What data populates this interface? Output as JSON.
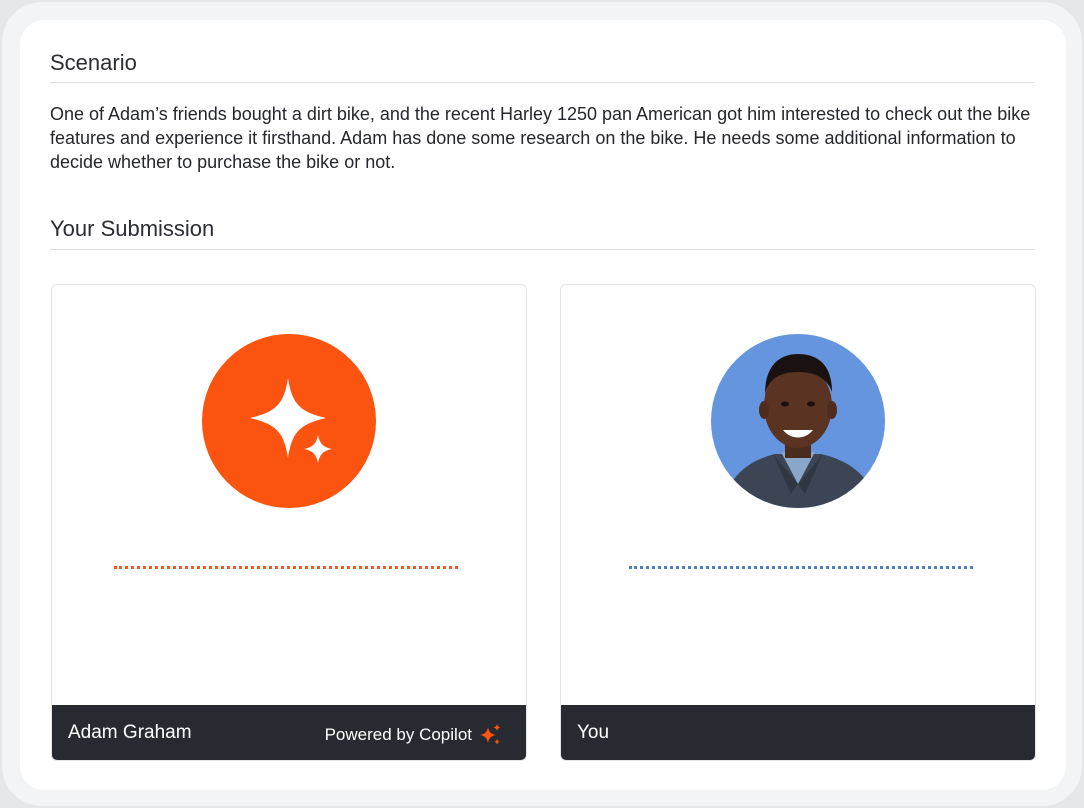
{
  "scenario": {
    "heading": "Scenario",
    "text": "One of Adam’s friends bought a dirt bike, and the recent Harley 1250 pan American got him interested to check out the bike features and experience it firsthand. Adam has done some research on the bike. He needs some additional information to decide whether to purchase the bike or not."
  },
  "submission": {
    "heading": "Your Submission",
    "cards": [
      {
        "name": "Adam Graham",
        "powered_by": "Powered by Copilot",
        "avatar_icon": "copilot-sparkle-icon",
        "accent": "#fb5410",
        "dots_color": "#f05a22"
      },
      {
        "name": "You",
        "avatar_icon": "user-photo-avatar",
        "accent": "#6495de",
        "dots_color": "#4e7fbe"
      }
    ]
  },
  "colors": {
    "footer_bg": "#272a31",
    "frame_bg": "#e6e7e9"
  }
}
